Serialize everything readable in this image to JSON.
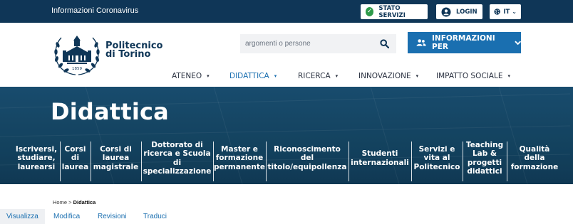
{
  "topbar": {
    "notice_link": "Informazioni Coronavirus",
    "stato_servizi": "STATO SERVIZI",
    "login": "LOGIN",
    "language": "IT"
  },
  "header": {
    "brand_line1": "Politecnico",
    "brand_line2": "di Torino",
    "logo_year": "1859",
    "search_placeholder": "argomenti o persone",
    "info_button": "INFORMAZIONI PER"
  },
  "nav": {
    "items": [
      {
        "label": "ATENEO"
      },
      {
        "label": "DIDATTICA"
      },
      {
        "label": "RICERCA"
      },
      {
        "label": "INNOVAZIONE"
      },
      {
        "label": "IMPATTO SOCIALE"
      }
    ],
    "active_index": 1
  },
  "hero": {
    "title": "Didattica",
    "subnav": [
      {
        "label": "Iscriversi,\nstudiare,\nlaurearsi"
      },
      {
        "label": "Corsi\ndi\nlaurea"
      },
      {
        "label": "Corsi di\nlaurea\nmagistrale"
      },
      {
        "label": "Dottorato di\nricerca e Scuola\ndi\nspecializzazione"
      },
      {
        "label": "Master e\nformazione\npermanente"
      },
      {
        "label": "Riconoscimento\ndel\ntitolo/equipollenza"
      },
      {
        "label": "Studenti\ninternazionali"
      },
      {
        "label": "Servizi e\nvita al\nPolitecnico"
      },
      {
        "label": "Teaching\nLab &\nprogetti\ndidattici"
      },
      {
        "label": "Qualità\ndella\nformazione"
      }
    ]
  },
  "breadcrumb": {
    "home": "Home",
    "separator": ">",
    "current": "Didattica"
  },
  "tabs": [
    {
      "label": "Visualizza"
    },
    {
      "label": "Modifica"
    },
    {
      "label": "Revisioni"
    },
    {
      "label": "Traduci"
    }
  ],
  "colors": {
    "navy": "#0f3657",
    "accent_blue": "#1a6fb0",
    "hero": "#184c6f",
    "green_check": "#2e9a4a"
  }
}
